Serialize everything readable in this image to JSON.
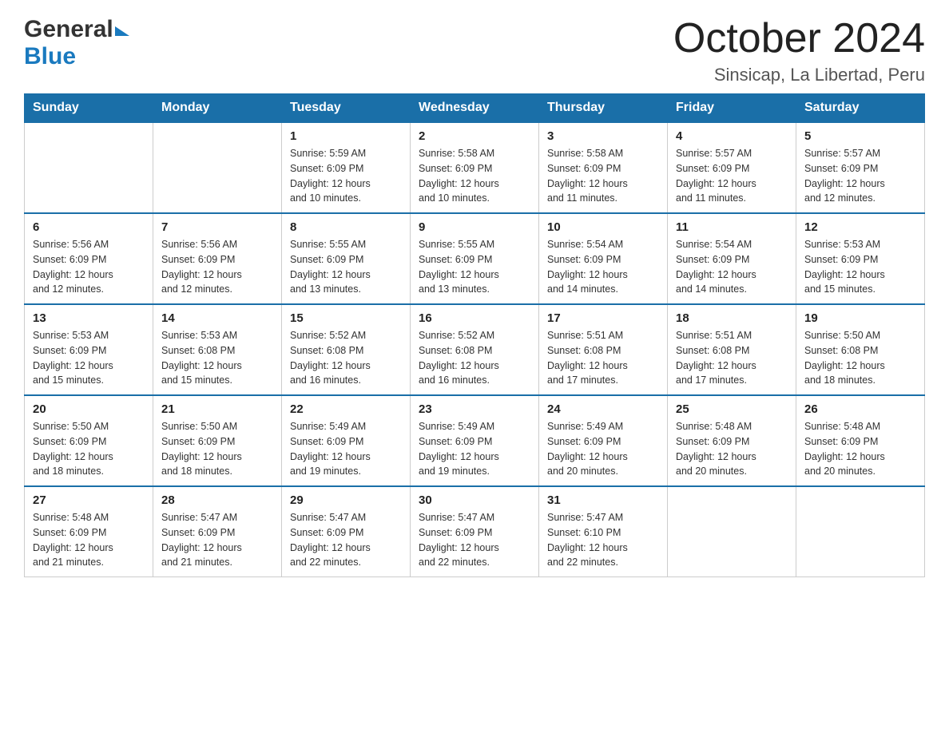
{
  "header": {
    "logo_general": "General",
    "logo_blue": "Blue",
    "title": "October 2024",
    "subtitle": "Sinsicap, La Libertad, Peru"
  },
  "weekdays": [
    "Sunday",
    "Monday",
    "Tuesday",
    "Wednesday",
    "Thursday",
    "Friday",
    "Saturday"
  ],
  "weeks": [
    [
      {
        "day": "",
        "sunrise": "",
        "sunset": "",
        "daylight": ""
      },
      {
        "day": "",
        "sunrise": "",
        "sunset": "",
        "daylight": ""
      },
      {
        "day": "1",
        "sunrise": "5:59 AM",
        "sunset": "6:09 PM",
        "daylight": "12 hours and 10 minutes."
      },
      {
        "day": "2",
        "sunrise": "5:58 AM",
        "sunset": "6:09 PM",
        "daylight": "12 hours and 10 minutes."
      },
      {
        "day": "3",
        "sunrise": "5:58 AM",
        "sunset": "6:09 PM",
        "daylight": "12 hours and 11 minutes."
      },
      {
        "day": "4",
        "sunrise": "5:57 AM",
        "sunset": "6:09 PM",
        "daylight": "12 hours and 11 minutes."
      },
      {
        "day": "5",
        "sunrise": "5:57 AM",
        "sunset": "6:09 PM",
        "daylight": "12 hours and 12 minutes."
      }
    ],
    [
      {
        "day": "6",
        "sunrise": "5:56 AM",
        "sunset": "6:09 PM",
        "daylight": "12 hours and 12 minutes."
      },
      {
        "day": "7",
        "sunrise": "5:56 AM",
        "sunset": "6:09 PM",
        "daylight": "12 hours and 12 minutes."
      },
      {
        "day": "8",
        "sunrise": "5:55 AM",
        "sunset": "6:09 PM",
        "daylight": "12 hours and 13 minutes."
      },
      {
        "day": "9",
        "sunrise": "5:55 AM",
        "sunset": "6:09 PM",
        "daylight": "12 hours and 13 minutes."
      },
      {
        "day": "10",
        "sunrise": "5:54 AM",
        "sunset": "6:09 PM",
        "daylight": "12 hours and 14 minutes."
      },
      {
        "day": "11",
        "sunrise": "5:54 AM",
        "sunset": "6:09 PM",
        "daylight": "12 hours and 14 minutes."
      },
      {
        "day": "12",
        "sunrise": "5:53 AM",
        "sunset": "6:09 PM",
        "daylight": "12 hours and 15 minutes."
      }
    ],
    [
      {
        "day": "13",
        "sunrise": "5:53 AM",
        "sunset": "6:09 PM",
        "daylight": "12 hours and 15 minutes."
      },
      {
        "day": "14",
        "sunrise": "5:53 AM",
        "sunset": "6:08 PM",
        "daylight": "12 hours and 15 minutes."
      },
      {
        "day": "15",
        "sunrise": "5:52 AM",
        "sunset": "6:08 PM",
        "daylight": "12 hours and 16 minutes."
      },
      {
        "day": "16",
        "sunrise": "5:52 AM",
        "sunset": "6:08 PM",
        "daylight": "12 hours and 16 minutes."
      },
      {
        "day": "17",
        "sunrise": "5:51 AM",
        "sunset": "6:08 PM",
        "daylight": "12 hours and 17 minutes."
      },
      {
        "day": "18",
        "sunrise": "5:51 AM",
        "sunset": "6:08 PM",
        "daylight": "12 hours and 17 minutes."
      },
      {
        "day": "19",
        "sunrise": "5:50 AM",
        "sunset": "6:08 PM",
        "daylight": "12 hours and 18 minutes."
      }
    ],
    [
      {
        "day": "20",
        "sunrise": "5:50 AM",
        "sunset": "6:09 PM",
        "daylight": "12 hours and 18 minutes."
      },
      {
        "day": "21",
        "sunrise": "5:50 AM",
        "sunset": "6:09 PM",
        "daylight": "12 hours and 18 minutes."
      },
      {
        "day": "22",
        "sunrise": "5:49 AM",
        "sunset": "6:09 PM",
        "daylight": "12 hours and 19 minutes."
      },
      {
        "day": "23",
        "sunrise": "5:49 AM",
        "sunset": "6:09 PM",
        "daylight": "12 hours and 19 minutes."
      },
      {
        "day": "24",
        "sunrise": "5:49 AM",
        "sunset": "6:09 PM",
        "daylight": "12 hours and 20 minutes."
      },
      {
        "day": "25",
        "sunrise": "5:48 AM",
        "sunset": "6:09 PM",
        "daylight": "12 hours and 20 minutes."
      },
      {
        "day": "26",
        "sunrise": "5:48 AM",
        "sunset": "6:09 PM",
        "daylight": "12 hours and 20 minutes."
      }
    ],
    [
      {
        "day": "27",
        "sunrise": "5:48 AM",
        "sunset": "6:09 PM",
        "daylight": "12 hours and 21 minutes."
      },
      {
        "day": "28",
        "sunrise": "5:47 AM",
        "sunset": "6:09 PM",
        "daylight": "12 hours and 21 minutes."
      },
      {
        "day": "29",
        "sunrise": "5:47 AM",
        "sunset": "6:09 PM",
        "daylight": "12 hours and 22 minutes."
      },
      {
        "day": "30",
        "sunrise": "5:47 AM",
        "sunset": "6:09 PM",
        "daylight": "12 hours and 22 minutes."
      },
      {
        "day": "31",
        "sunrise": "5:47 AM",
        "sunset": "6:10 PM",
        "daylight": "12 hours and 22 minutes."
      },
      {
        "day": "",
        "sunrise": "",
        "sunset": "",
        "daylight": ""
      },
      {
        "day": "",
        "sunrise": "",
        "sunset": "",
        "daylight": ""
      }
    ]
  ],
  "labels": {
    "sunrise": "Sunrise: ",
    "sunset": "Sunset: ",
    "daylight": "Daylight: "
  }
}
